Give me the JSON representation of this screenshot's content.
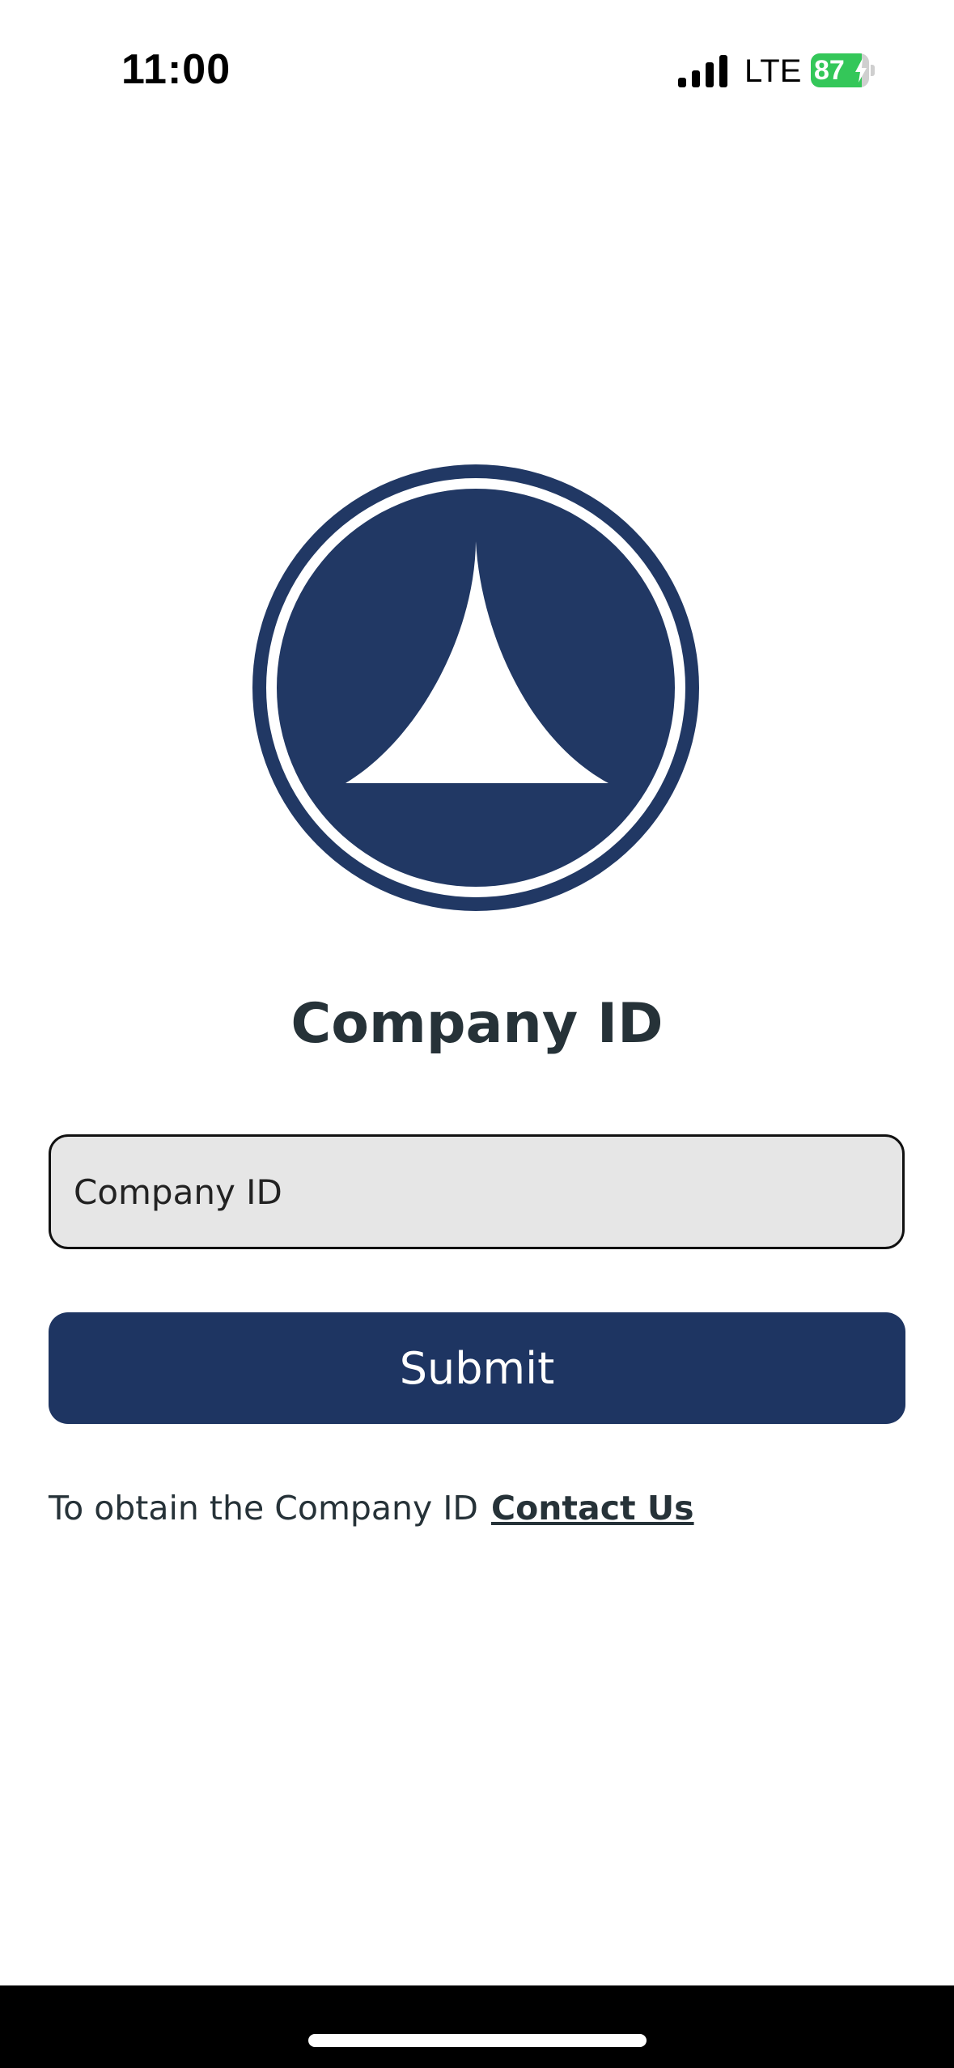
{
  "status_bar": {
    "time": "11:00",
    "network": "LTE",
    "battery": "87",
    "battery_level": 0.87
  },
  "logo": {
    "icon": "tent-peak-circle-logo",
    "color": "#213864"
  },
  "page": {
    "title": "Company ID"
  },
  "form": {
    "company_id_placeholder": "Company ID",
    "company_id_value": "",
    "submit_label": "Submit"
  },
  "footer": {
    "help_text": "To obtain the Company ID",
    "contact_link": "Contact Us"
  },
  "colors": {
    "primary": "#1e3562",
    "text": "#263238",
    "input_background": "#e6e6e6",
    "battery_green": "#34c759"
  }
}
